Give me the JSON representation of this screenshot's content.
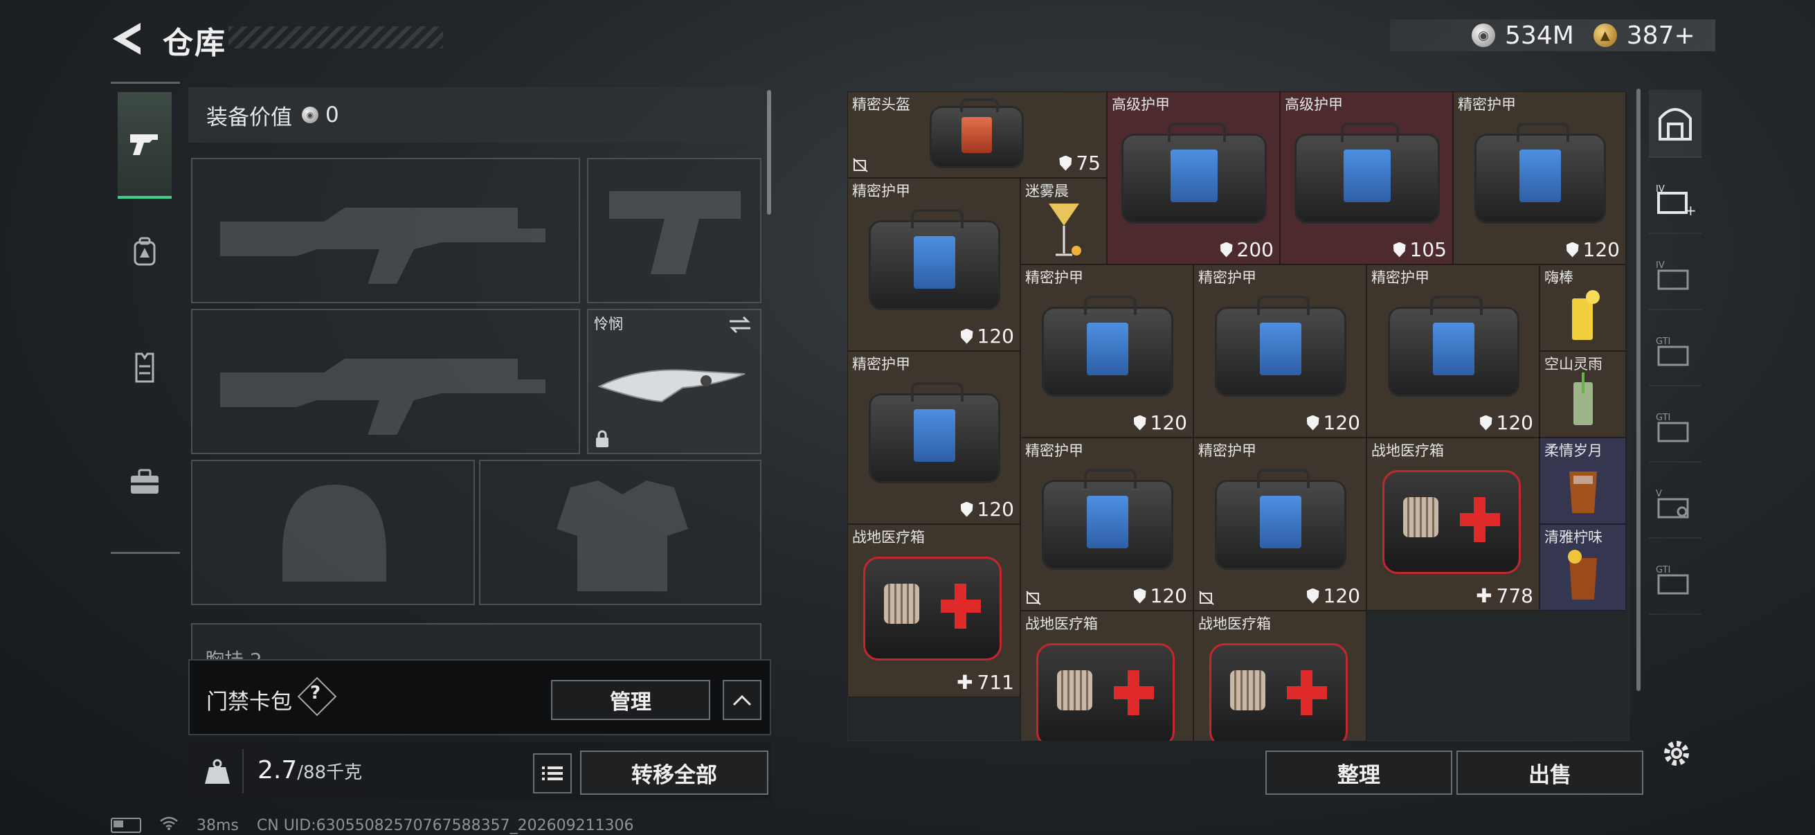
{
  "header": {
    "title": "仓库"
  },
  "currency": {
    "silver": "534M",
    "gold": "387+"
  },
  "left_tabs": [
    {
      "icon": "pistol-icon",
      "active": true
    },
    {
      "icon": "backpack-icon",
      "active": false
    },
    {
      "icon": "vest-icon",
      "active": false
    },
    {
      "icon": "toolbox-icon",
      "active": false
    }
  ],
  "equipment": {
    "value_label": "装备价值",
    "value": "0",
    "melee_slot_name": "怜悯",
    "next_section_partial": "胸挂 2"
  },
  "keycard": {
    "label": "门禁卡包",
    "help": "?",
    "manage": "管理"
  },
  "weight": {
    "current": "2.7",
    "max": "/88千克",
    "transfer_all": "转移全部"
  },
  "inventory": {
    "items": [
      {
        "name": "精密头盔",
        "value": "75",
        "kind": "shield"
      },
      {
        "name": "高级护甲",
        "value": "200",
        "kind": "shield"
      },
      {
        "name": "高级护甲",
        "value": "105",
        "kind": "shield"
      },
      {
        "name": "精密护甲",
        "value": "120",
        "kind": "shield"
      },
      {
        "name": "迷雾晨",
        "value": "",
        "kind": "none"
      },
      {
        "name": "精密护甲",
        "value": "120",
        "kind": "shield"
      },
      {
        "name": "精密护甲",
        "value": "120",
        "kind": "shield"
      },
      {
        "name": "精密护甲",
        "value": "120",
        "kind": "shield"
      },
      {
        "name": "精密护甲",
        "value": "120",
        "kind": "shield"
      },
      {
        "name": "嗨棒",
        "value": "",
        "kind": "none"
      },
      {
        "name": "精密护甲",
        "value": "120",
        "kind": "shield"
      },
      {
        "name": "空山灵雨",
        "value": "",
        "kind": "none"
      },
      {
        "name": "精密护甲",
        "value": "120",
        "kind": "shield"
      },
      {
        "name": "精密护甲",
        "value": "120",
        "kind": "shield"
      },
      {
        "name": "战地医疗箱",
        "value": "778",
        "kind": "plus"
      },
      {
        "name": "柔情岁月",
        "value": "",
        "kind": "none"
      },
      {
        "name": "战地医疗箱",
        "value": "711",
        "kind": "plus"
      },
      {
        "name": "清雅柠味",
        "value": "",
        "kind": "none"
      },
      {
        "name": "战地医疗箱",
        "value": "",
        "kind": "none"
      },
      {
        "name": "战地医疗箱",
        "value": "",
        "kind": "none"
      }
    ],
    "sort": "整理",
    "sell": "出售"
  },
  "right_nav": [
    {
      "icon": "safe-box-icon"
    },
    {
      "icon": "level4-add-icon"
    },
    {
      "icon": "level4-folder-icon"
    },
    {
      "icon": "gti-lock-icon"
    },
    {
      "icon": "gti-folder-icon"
    },
    {
      "icon": "v-search-icon"
    },
    {
      "icon": "gti-box-icon"
    }
  ],
  "status_bar": {
    "ping": "38ms",
    "uid": "CN UID:6305508257076758835​7_202609211306"
  }
}
